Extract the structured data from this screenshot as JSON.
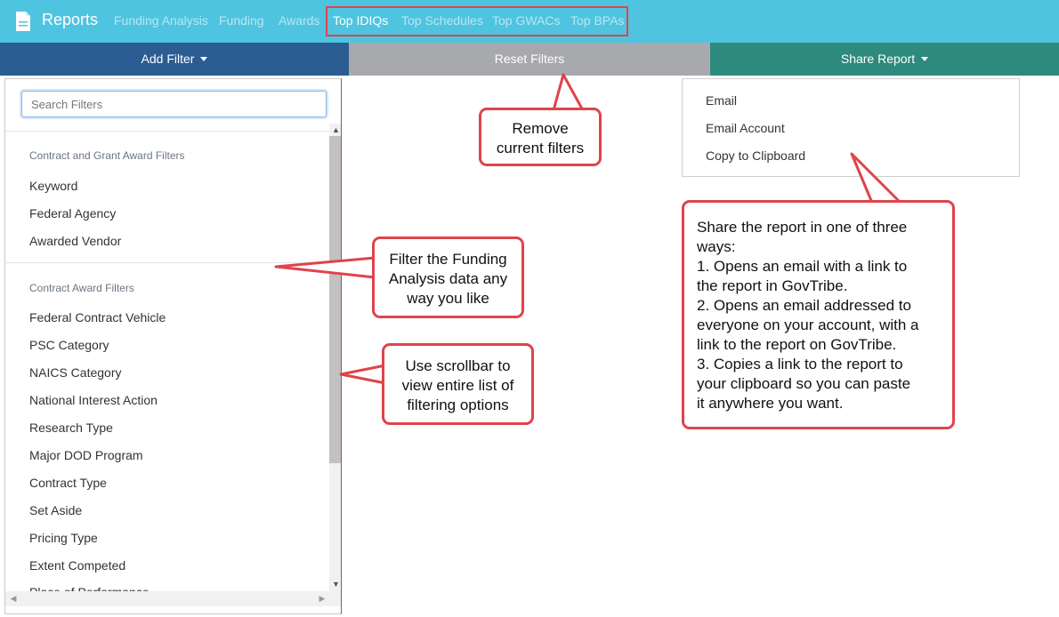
{
  "nav": {
    "brand": "Reports",
    "links": [
      "Funding Analysis",
      "Funding",
      "Awards",
      "Top IDIQs",
      "Top Schedules",
      "Top GWACs",
      "Top BPAs"
    ]
  },
  "actions": {
    "add_filter": "Add Filter",
    "reset_filters": "Reset Filters",
    "share_report": "Share Report"
  },
  "filters": {
    "search_placeholder": "Search Filters",
    "section1": "Contract and Grant Award Filters",
    "section1_items": [
      "Keyword",
      "Federal Agency",
      "Awarded Vendor"
    ],
    "section2": "Contract Award Filters",
    "section2_items": [
      "Federal Contract Vehicle",
      "PSC Category",
      "NAICS Category",
      "National Interest Action",
      "Research Type",
      "Major DOD Program",
      "Contract Type",
      "Set Aside",
      "Pricing Type",
      "Extent Competed",
      "Place of Performance"
    ]
  },
  "share_menu": [
    "Email",
    "Email Account",
    "Copy to Clipboard"
  ],
  "callouts": {
    "remove": [
      "Remove",
      "current filters"
    ],
    "filter": [
      "Filter the Funding",
      "Analysis data any",
      "way you like"
    ],
    "scroll": [
      "Use scrollbar to",
      "view entire list of",
      "filtering options"
    ],
    "share": [
      "Share the report in one of three",
      "ways:",
      "1. Opens an email with a link to",
      "the report in GovTribe.",
      "2. Opens an email addressed to",
      "everyone on your account, with a",
      "link to the report on GovTribe.",
      "3. Copies a link to the report to",
      "your clipboard so you can paste",
      "it anywhere you want."
    ]
  },
  "colors": {
    "nav_bg": "#4fc4e0",
    "add_filter_bg": "#2b5c92",
    "reset_bg": "#a8a9ad",
    "share_bg": "#2d8a7c",
    "callout_border": "#e0434b"
  }
}
